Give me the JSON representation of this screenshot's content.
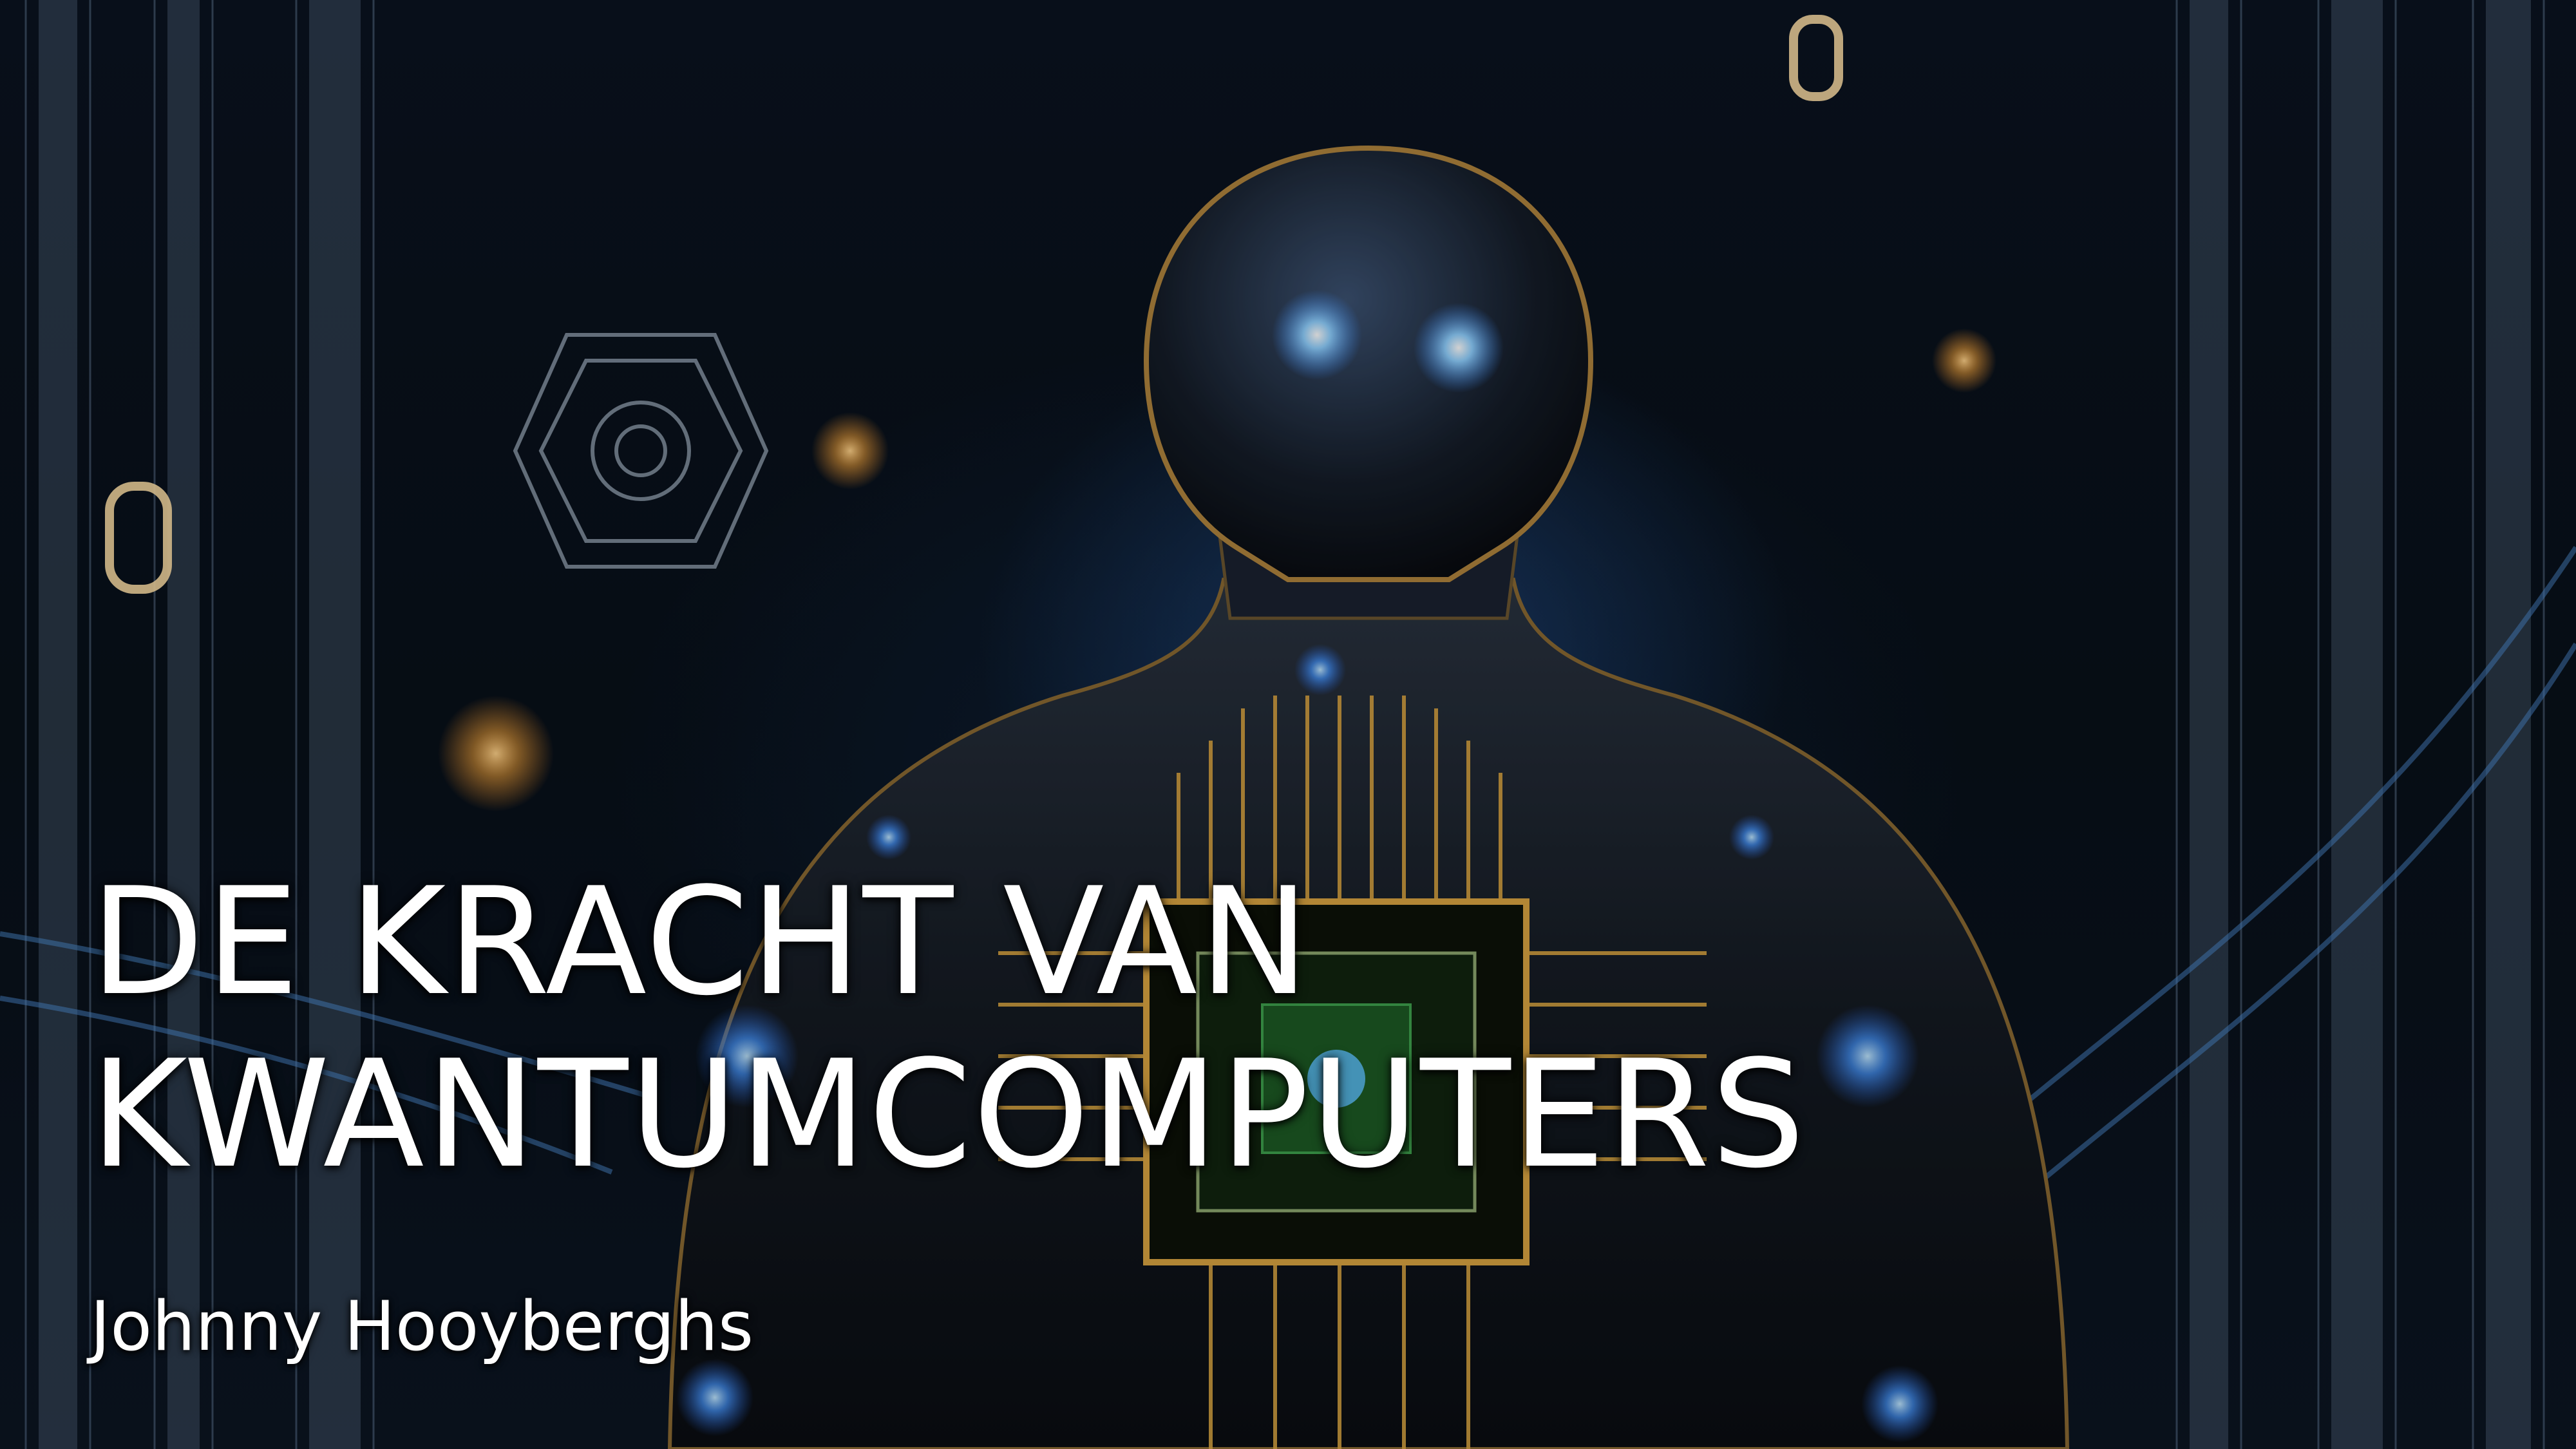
{
  "slide": {
    "title_line1": "DE KRACHT VAN",
    "title_line2": "KWANTUMCOMPUTERS",
    "subtitle": "Johnny Hooyberghs",
    "background_image": {
      "description_icon": "robot-chip-illustration",
      "decor_glyphs": [
        "0",
        "0"
      ]
    }
  },
  "colors": {
    "title_text": "#ffffff",
    "background_dark": "#05080f",
    "glow_blue": "#4aa3ff",
    "circuit_gold": "#d9a441",
    "chip_green": "#2c8a3a"
  }
}
